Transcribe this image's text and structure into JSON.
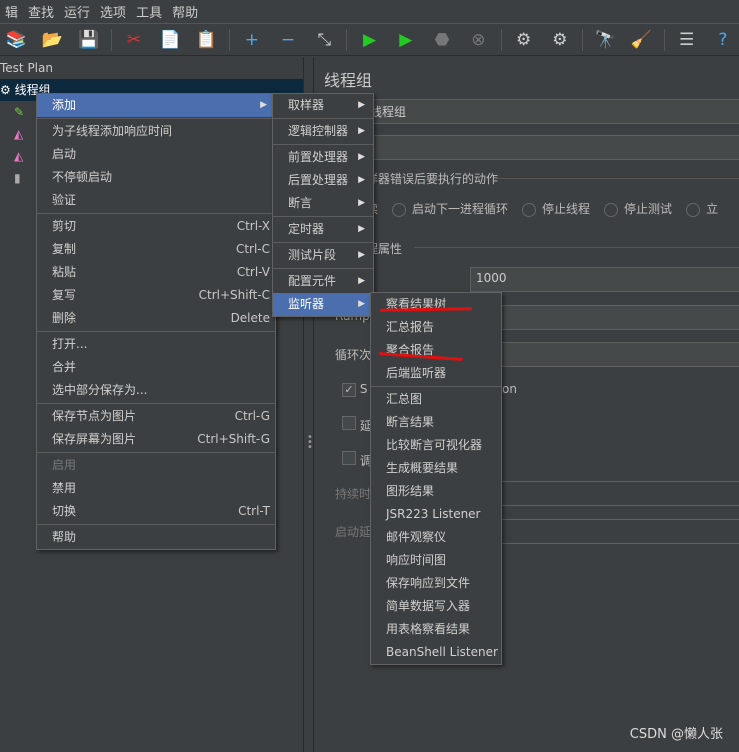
{
  "menubar": [
    "辑",
    "查找",
    "运行",
    "选项",
    "工具",
    "帮助"
  ],
  "toolbar": [
    {
      "name": "templates-icon",
      "g": "📚"
    },
    {
      "name": "open-icon",
      "g": "📂"
    },
    {
      "name": "save-icon",
      "g": "💾"
    },
    "sep",
    {
      "name": "cut-icon",
      "g": "✂"
    },
    {
      "name": "copy-icon",
      "g": "📄"
    },
    {
      "name": "paste-icon",
      "g": "📋"
    },
    "sep",
    {
      "name": "expand-icon",
      "g": "+"
    },
    {
      "name": "collapse-icon",
      "g": "−"
    },
    {
      "name": "toggle-icon",
      "g": "⤡"
    },
    "sep",
    {
      "name": "start-icon",
      "g": "▶"
    },
    {
      "name": "start-no-pause-icon",
      "g": "▶"
    },
    {
      "name": "stop-icon",
      "g": "⬣"
    },
    {
      "name": "shutdown-icon",
      "g": "⊗"
    },
    "sep",
    {
      "name": "clear-icon",
      "g": "⚙"
    },
    {
      "name": "clear-all-icon",
      "g": "⚙"
    },
    "sep",
    {
      "name": "search-icon",
      "g": "🔭"
    },
    {
      "name": "reset-search-icon",
      "g": "🧹"
    },
    "sep",
    {
      "name": "function-helper-icon",
      "g": "☰"
    },
    {
      "name": "help-icon",
      "g": "?"
    }
  ],
  "tree": {
    "root": "Test Plan",
    "thread_group": "线程组"
  },
  "right": {
    "title": "线程组",
    "name_value": "线程组",
    "error_action_label": "取样器错误后要执行的动作",
    "radios": [
      "继续",
      "启动下一进程循环",
      "停止线程",
      "停止测试",
      "立"
    ],
    "thread_props_label": "线程属性",
    "threads_value": "1000",
    "ramp_label": "Ramp",
    "loop_label": "循环次",
    "same_user_label": "S",
    "same_user_suffix": "on",
    "delay_label": "延",
    "scheduler_label": "调",
    "duration_label": "持续时",
    "startup_delay_label": "启动延"
  },
  "context_menu": [
    {
      "label": "添加",
      "arrow": true,
      "selected": true
    },
    "sep",
    {
      "label": "为子线程添加响应时间"
    },
    {
      "label": "启动"
    },
    {
      "label": "不停顿启动"
    },
    {
      "label": "验证"
    },
    "sep",
    {
      "label": "剪切",
      "shortcut": "Ctrl-X"
    },
    {
      "label": "复制",
      "shortcut": "Ctrl-C"
    },
    {
      "label": "粘贴",
      "shortcut": "Ctrl-V"
    },
    {
      "label": "复写",
      "shortcut": "Ctrl+Shift-C"
    },
    {
      "label": "删除",
      "shortcut": "Delete"
    },
    "sep",
    {
      "label": "打开..."
    },
    {
      "label": "合并"
    },
    {
      "label": "选中部分保存为..."
    },
    "sep",
    {
      "label": "保存节点为图片",
      "shortcut": "Ctrl-G"
    },
    {
      "label": "保存屏幕为图片",
      "shortcut": "Ctrl+Shift-G"
    },
    "sep",
    {
      "label": "启用",
      "disabled": true
    },
    {
      "label": "禁用"
    },
    {
      "label": "切换",
      "shortcut": "Ctrl-T"
    },
    "sep",
    {
      "label": "帮助"
    }
  ],
  "add_menu": [
    {
      "label": "取样器",
      "arrow": true
    },
    "sep",
    {
      "label": "逻辑控制器",
      "arrow": true
    },
    "sep",
    {
      "label": "前置处理器",
      "arrow": true
    },
    {
      "label": "后置处理器",
      "arrow": true
    },
    {
      "label": "断言",
      "arrow": true
    },
    "sep",
    {
      "label": "定时器",
      "arrow": true
    },
    "sep",
    {
      "label": "测试片段",
      "arrow": true
    },
    "sep",
    {
      "label": "配置元件",
      "arrow": true
    },
    {
      "label": "监听器",
      "arrow": true,
      "selected": true
    }
  ],
  "listener_menu": [
    {
      "label": "察看结果树"
    },
    {
      "label": "汇总报告"
    },
    {
      "label": "聚合报告"
    },
    {
      "label": "后端监听器"
    },
    "sep",
    {
      "label": "汇总图"
    },
    {
      "label": "断言结果"
    },
    {
      "label": "比较断言可视化器"
    },
    {
      "label": "生成概要结果"
    },
    {
      "label": "图形结果"
    },
    {
      "label": "JSR223 Listener"
    },
    {
      "label": "邮件观察仪"
    },
    {
      "label": "响应时间图"
    },
    {
      "label": "保存响应到文件"
    },
    {
      "label": "简单数据写入器"
    },
    {
      "label": "用表格察看结果"
    },
    {
      "label": "BeanShell Listener"
    }
  ],
  "annotation_color": "#e01010",
  "watermark": "CSDN @懒人张"
}
